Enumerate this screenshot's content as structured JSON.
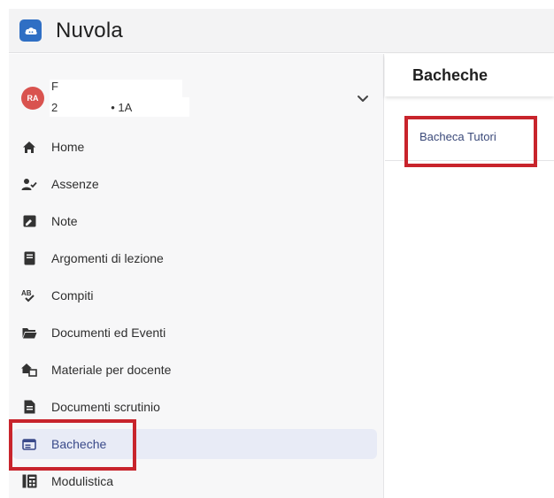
{
  "app": {
    "title": "Nuvola",
    "brand_color": "#2f6fc4"
  },
  "user": {
    "initials": "RA",
    "name": "F",
    "class_prefix": "2",
    "class": "• 1A"
  },
  "nav": [
    {
      "label": "Home",
      "icon": "home-icon"
    },
    {
      "label": "Assenze",
      "icon": "user-check-icon"
    },
    {
      "label": "Note",
      "icon": "note-icon"
    },
    {
      "label": "Argomenti di lezione",
      "icon": "book-icon"
    },
    {
      "label": "Compiti",
      "icon": "spellcheck-icon"
    },
    {
      "label": "Documenti ed Eventi",
      "icon": "folder-icon"
    },
    {
      "label": "Materiale per docente",
      "icon": "house-share-icon"
    },
    {
      "label": "Documenti scrutinio",
      "icon": "document-icon"
    },
    {
      "label": "Bacheche",
      "icon": "board-icon",
      "active": true
    },
    {
      "label": "Modulistica",
      "icon": "forms-icon"
    }
  ],
  "panel": {
    "title": "Bacheche",
    "items": [
      "Bacheca Tutori"
    ]
  },
  "colors": {
    "highlight": "#c8242c",
    "active_bg": "#e8ebf6"
  }
}
